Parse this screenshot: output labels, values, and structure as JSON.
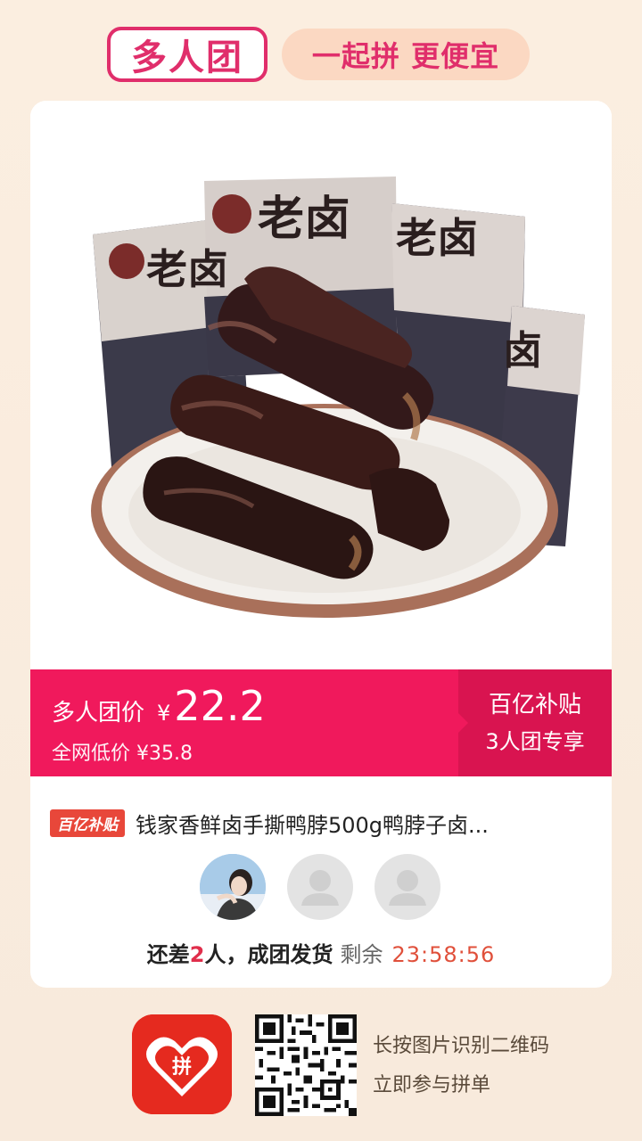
{
  "header": {
    "logo_text": "多人团",
    "slogan": "一起拼 更便宜"
  },
  "product": {
    "image_alt": "钱家香老卤鸭脖 product photo",
    "price_label": "多人团价",
    "currency": "¥",
    "price": "22.2",
    "original_label": "全网低价 ¥35.8",
    "subsidy_title": "百亿补贴",
    "subsidy_sub": "3人团专享",
    "tag": "百亿补贴",
    "title": "钱家香鲜卤手撕鸭脖500g鸭脖子卤..."
  },
  "group": {
    "status_prefix": "还差",
    "missing_count": "2",
    "status_suffix": "人，成团发货",
    "remaining_label": "剩余",
    "countdown": "23:58:56"
  },
  "footer": {
    "qr_hint_line1": "长按图片识别二维码",
    "qr_hint_line2": "立即参与拼单"
  },
  "colors": {
    "accent": "#f0195c",
    "accent_dark": "#d91450",
    "logo_pink": "#e02e6b",
    "app_red": "#e52a1f",
    "background": "#fbeee0"
  },
  "icons": [
    "avatar-photo",
    "avatar-placeholder-icon",
    "app-logo-icon",
    "qr-code"
  ]
}
